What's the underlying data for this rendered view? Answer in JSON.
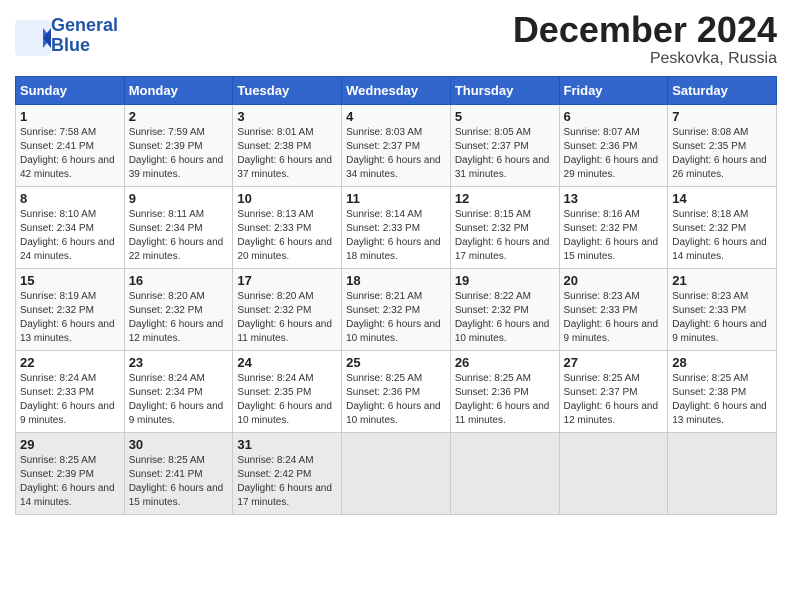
{
  "header": {
    "logo_line1": "General",
    "logo_line2": "Blue",
    "month": "December 2024",
    "location": "Peskovka, Russia"
  },
  "columns": [
    "Sunday",
    "Monday",
    "Tuesday",
    "Wednesday",
    "Thursday",
    "Friday",
    "Saturday"
  ],
  "weeks": [
    [
      {
        "day": "1",
        "text": "Sunrise: 7:58 AM\nSunset: 2:41 PM\nDaylight: 6 hours and 42 minutes."
      },
      {
        "day": "2",
        "text": "Sunrise: 7:59 AM\nSunset: 2:39 PM\nDaylight: 6 hours and 39 minutes."
      },
      {
        "day": "3",
        "text": "Sunrise: 8:01 AM\nSunset: 2:38 PM\nDaylight: 6 hours and 37 minutes."
      },
      {
        "day": "4",
        "text": "Sunrise: 8:03 AM\nSunset: 2:37 PM\nDaylight: 6 hours and 34 minutes."
      },
      {
        "day": "5",
        "text": "Sunrise: 8:05 AM\nSunset: 2:37 PM\nDaylight: 6 hours and 31 minutes."
      },
      {
        "day": "6",
        "text": "Sunrise: 8:07 AM\nSunset: 2:36 PM\nDaylight: 6 hours and 29 minutes."
      },
      {
        "day": "7",
        "text": "Sunrise: 8:08 AM\nSunset: 2:35 PM\nDaylight: 6 hours and 26 minutes."
      }
    ],
    [
      {
        "day": "8",
        "text": "Sunrise: 8:10 AM\nSunset: 2:34 PM\nDaylight: 6 hours and 24 minutes."
      },
      {
        "day": "9",
        "text": "Sunrise: 8:11 AM\nSunset: 2:34 PM\nDaylight: 6 hours and 22 minutes."
      },
      {
        "day": "10",
        "text": "Sunrise: 8:13 AM\nSunset: 2:33 PM\nDaylight: 6 hours and 20 minutes."
      },
      {
        "day": "11",
        "text": "Sunrise: 8:14 AM\nSunset: 2:33 PM\nDaylight: 6 hours and 18 minutes."
      },
      {
        "day": "12",
        "text": "Sunrise: 8:15 AM\nSunset: 2:32 PM\nDaylight: 6 hours and 17 minutes."
      },
      {
        "day": "13",
        "text": "Sunrise: 8:16 AM\nSunset: 2:32 PM\nDaylight: 6 hours and 15 minutes."
      },
      {
        "day": "14",
        "text": "Sunrise: 8:18 AM\nSunset: 2:32 PM\nDaylight: 6 hours and 14 minutes."
      }
    ],
    [
      {
        "day": "15",
        "text": "Sunrise: 8:19 AM\nSunset: 2:32 PM\nDaylight: 6 hours and 13 minutes."
      },
      {
        "day": "16",
        "text": "Sunrise: 8:20 AM\nSunset: 2:32 PM\nDaylight: 6 hours and 12 minutes."
      },
      {
        "day": "17",
        "text": "Sunrise: 8:20 AM\nSunset: 2:32 PM\nDaylight: 6 hours and 11 minutes."
      },
      {
        "day": "18",
        "text": "Sunrise: 8:21 AM\nSunset: 2:32 PM\nDaylight: 6 hours and 10 minutes."
      },
      {
        "day": "19",
        "text": "Sunrise: 8:22 AM\nSunset: 2:32 PM\nDaylight: 6 hours and 10 minutes."
      },
      {
        "day": "20",
        "text": "Sunrise: 8:23 AM\nSunset: 2:33 PM\nDaylight: 6 hours and 9 minutes."
      },
      {
        "day": "21",
        "text": "Sunrise: 8:23 AM\nSunset: 2:33 PM\nDaylight: 6 hours and 9 minutes."
      }
    ],
    [
      {
        "day": "22",
        "text": "Sunrise: 8:24 AM\nSunset: 2:33 PM\nDaylight: 6 hours and 9 minutes."
      },
      {
        "day": "23",
        "text": "Sunrise: 8:24 AM\nSunset: 2:34 PM\nDaylight: 6 hours and 9 minutes."
      },
      {
        "day": "24",
        "text": "Sunrise: 8:24 AM\nSunset: 2:35 PM\nDaylight: 6 hours and 10 minutes."
      },
      {
        "day": "25",
        "text": "Sunrise: 8:25 AM\nSunset: 2:36 PM\nDaylight: 6 hours and 10 minutes."
      },
      {
        "day": "26",
        "text": "Sunrise: 8:25 AM\nSunset: 2:36 PM\nDaylight: 6 hours and 11 minutes."
      },
      {
        "day": "27",
        "text": "Sunrise: 8:25 AM\nSunset: 2:37 PM\nDaylight: 6 hours and 12 minutes."
      },
      {
        "day": "28",
        "text": "Sunrise: 8:25 AM\nSunset: 2:38 PM\nDaylight: 6 hours and 13 minutes."
      }
    ],
    [
      {
        "day": "29",
        "text": "Sunrise: 8:25 AM\nSunset: 2:39 PM\nDaylight: 6 hours and 14 minutes."
      },
      {
        "day": "30",
        "text": "Sunrise: 8:25 AM\nSunset: 2:41 PM\nDaylight: 6 hours and 15 minutes."
      },
      {
        "day": "31",
        "text": "Sunrise: 8:24 AM\nSunset: 2:42 PM\nDaylight: 6 hours and 17 minutes."
      },
      {
        "day": "",
        "text": ""
      },
      {
        "day": "",
        "text": ""
      },
      {
        "day": "",
        "text": ""
      },
      {
        "day": "",
        "text": ""
      }
    ]
  ]
}
